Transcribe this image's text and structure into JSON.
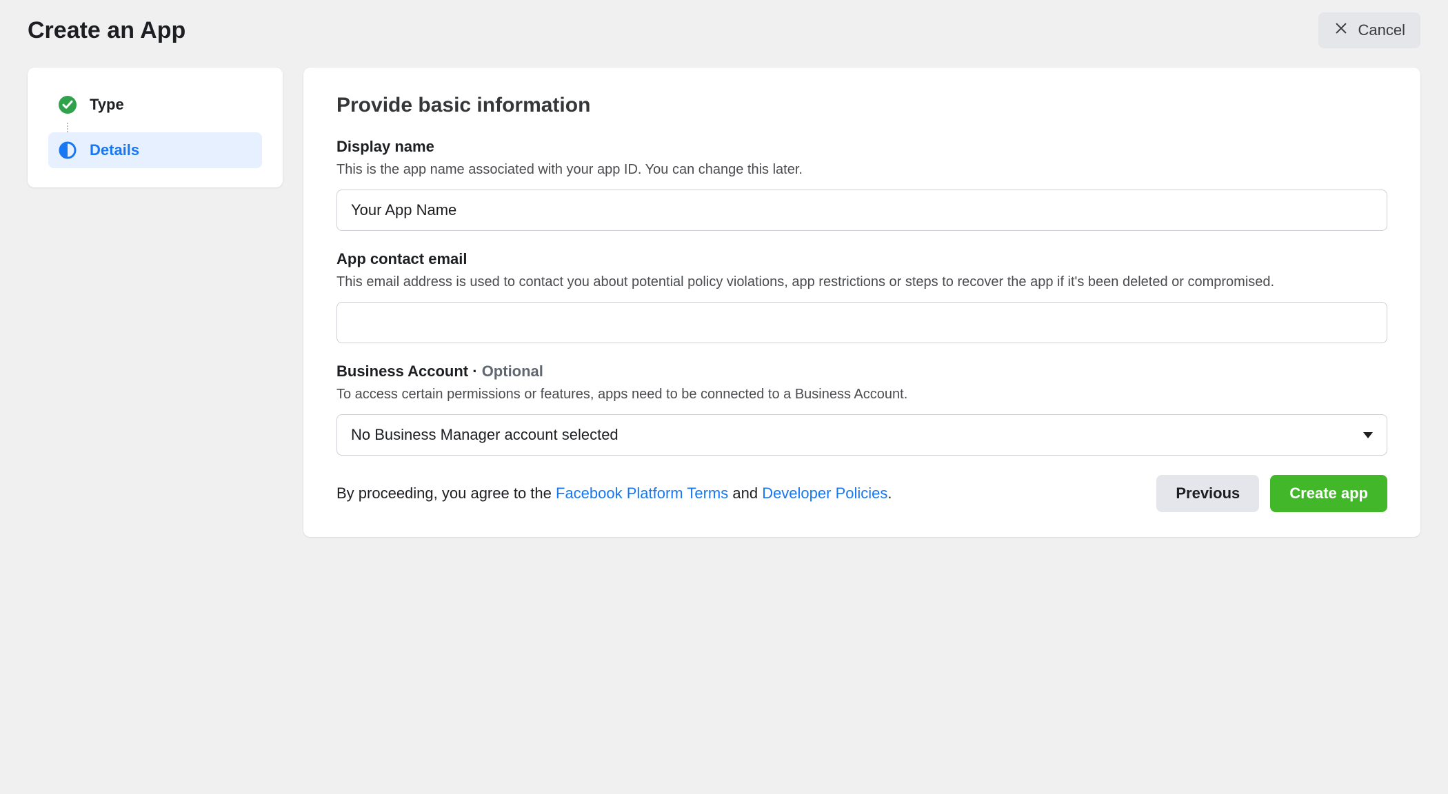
{
  "header": {
    "title": "Create an App",
    "cancel_label": "Cancel"
  },
  "sidebar": {
    "steps": [
      {
        "label": "Type",
        "state": "done"
      },
      {
        "label": "Details",
        "state": "active"
      }
    ]
  },
  "main": {
    "heading": "Provide basic information",
    "fields": {
      "display_name": {
        "label": "Display name",
        "description": "This is the app name associated with your app ID. You can change this later.",
        "value": "Your App Name"
      },
      "contact_email": {
        "label": "App contact email",
        "description": "This email address is used to contact you about potential policy violations, app restrictions or steps to recover the app if it's been deleted or compromised.",
        "value": ""
      },
      "business_account": {
        "label": "Business Account",
        "optional_separator": " · ",
        "optional_text": "Optional",
        "description": "To access certain permissions or features, apps need to be connected to a Business Account.",
        "selected": "No Business Manager account selected"
      }
    },
    "terms": {
      "prefix": "By proceeding, you agree to the ",
      "link1": "Facebook Platform Terms",
      "mid": " and ",
      "link2": "Developer Policies",
      "suffix": "."
    },
    "buttons": {
      "previous": "Previous",
      "create": "Create app"
    }
  }
}
